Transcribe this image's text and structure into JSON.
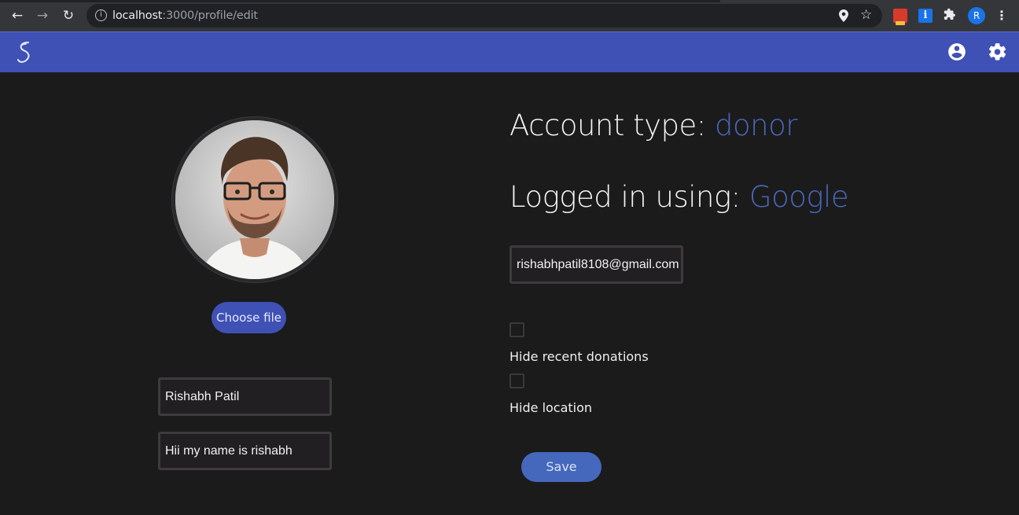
{
  "browser": {
    "url_host": "localhost",
    "url_rest": ":3000/profile/edit",
    "profile_initial": "R"
  },
  "appbar": {
    "color": "#3f51b5"
  },
  "profile": {
    "choose_file_label": "Choose file",
    "name_value": "Rishabh Patil",
    "bio_value": "Hii my name is rishabh",
    "account_type_label": "Account type:",
    "account_type_value": "donor",
    "logged_in_label": "Logged in using:",
    "logged_in_value": "Google",
    "email_value": "rishabhpatil8108@gmail.com",
    "hide_donations_label": "Hide recent donations",
    "hide_donations_checked": false,
    "hide_location_label": "Hide location",
    "hide_location_checked": false,
    "save_label": "Save"
  },
  "colors": {
    "accent_text": "#4a68b8",
    "background": "#1b1b1c",
    "button": "#3f51b5"
  },
  "icons": [
    "back-icon",
    "forward-icon",
    "reload-icon",
    "info-icon",
    "location-pin-icon",
    "bookmark-star-icon",
    "extension-icon",
    "puzzle-icon",
    "menu-dots-icon",
    "app-logo-icon",
    "account-circle-icon",
    "settings-icon"
  ]
}
